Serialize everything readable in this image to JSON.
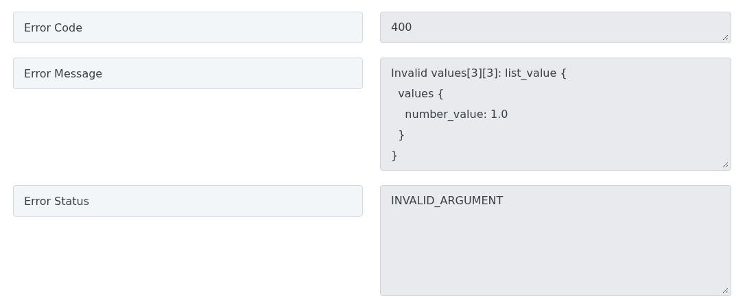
{
  "fields": [
    {
      "label": "Error Code",
      "value": "400"
    },
    {
      "label": "Error Message",
      "value": "Invalid values[3][3]: list_value {\n  values {\n    number_value: 1.0\n  }\n}"
    },
    {
      "label": "Error Status",
      "value": "INVALID_ARGUMENT"
    }
  ]
}
